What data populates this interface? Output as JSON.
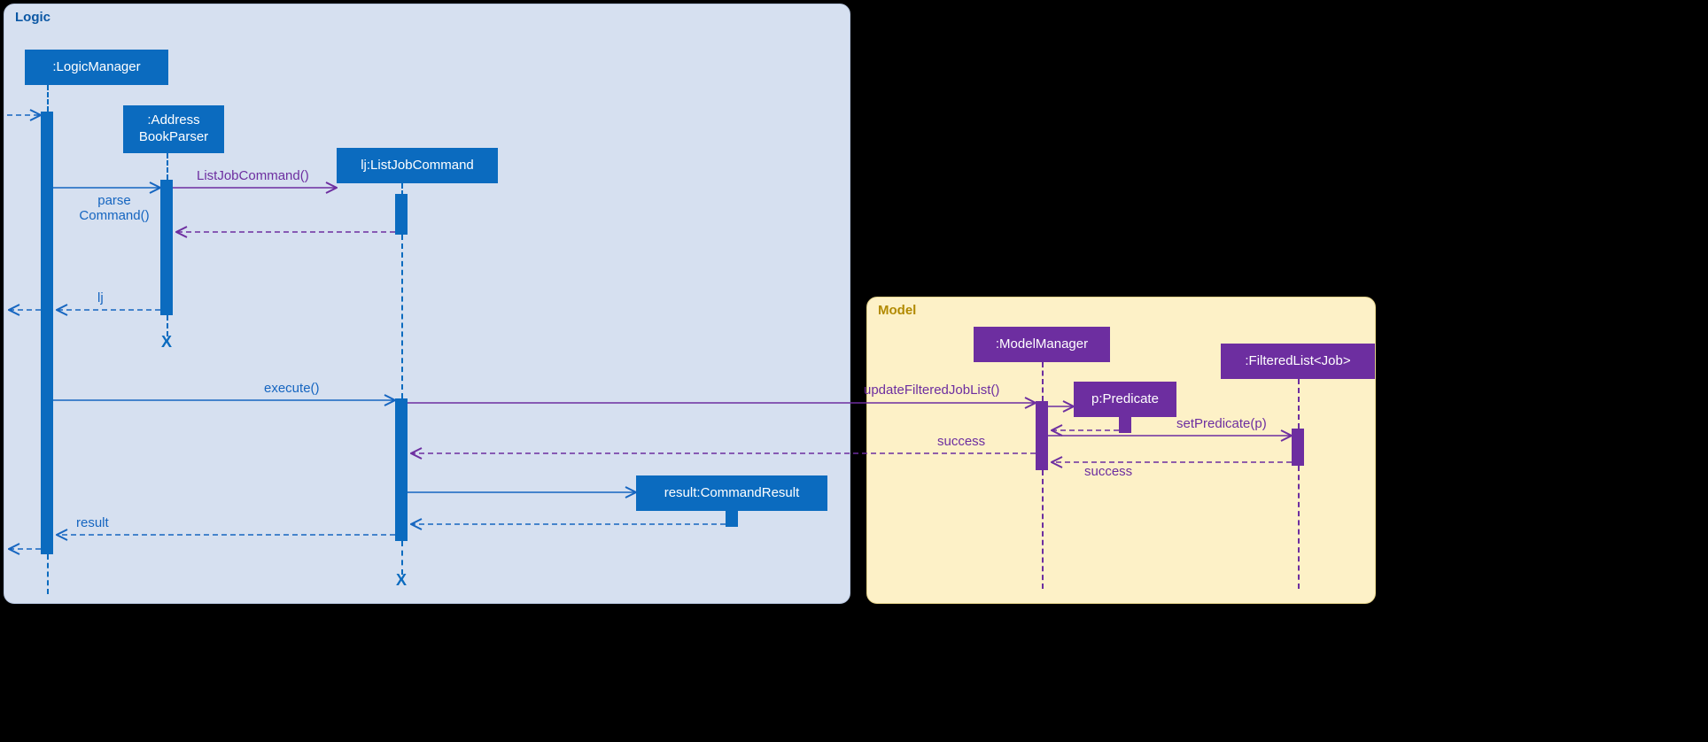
{
  "frames": {
    "logic_label": "Logic",
    "model_label": "Model"
  },
  "objects": {
    "logic_manager": ":LogicManager",
    "address_book_parser": ":Address\nBookParser",
    "list_job_command": "lj:ListJobCommand",
    "command_result": "result:CommandResult",
    "model_manager": ":ModelManager",
    "predicate": "p:Predicate",
    "filtered_list": ":FilteredList<Job>"
  },
  "messages": {
    "parse_command": "parse\nCommand()",
    "list_job_command_ctor": "ListJobCommand()",
    "lj_return": "lj",
    "execute": "execute()",
    "update_filtered": "updateFilteredJobList()",
    "set_predicate": "setPredicate(p)",
    "success1": "success",
    "success2": "success",
    "result_return": "result"
  },
  "colors": {
    "blue": "#0b6bbf",
    "purple": "#6d2ea0"
  }
}
